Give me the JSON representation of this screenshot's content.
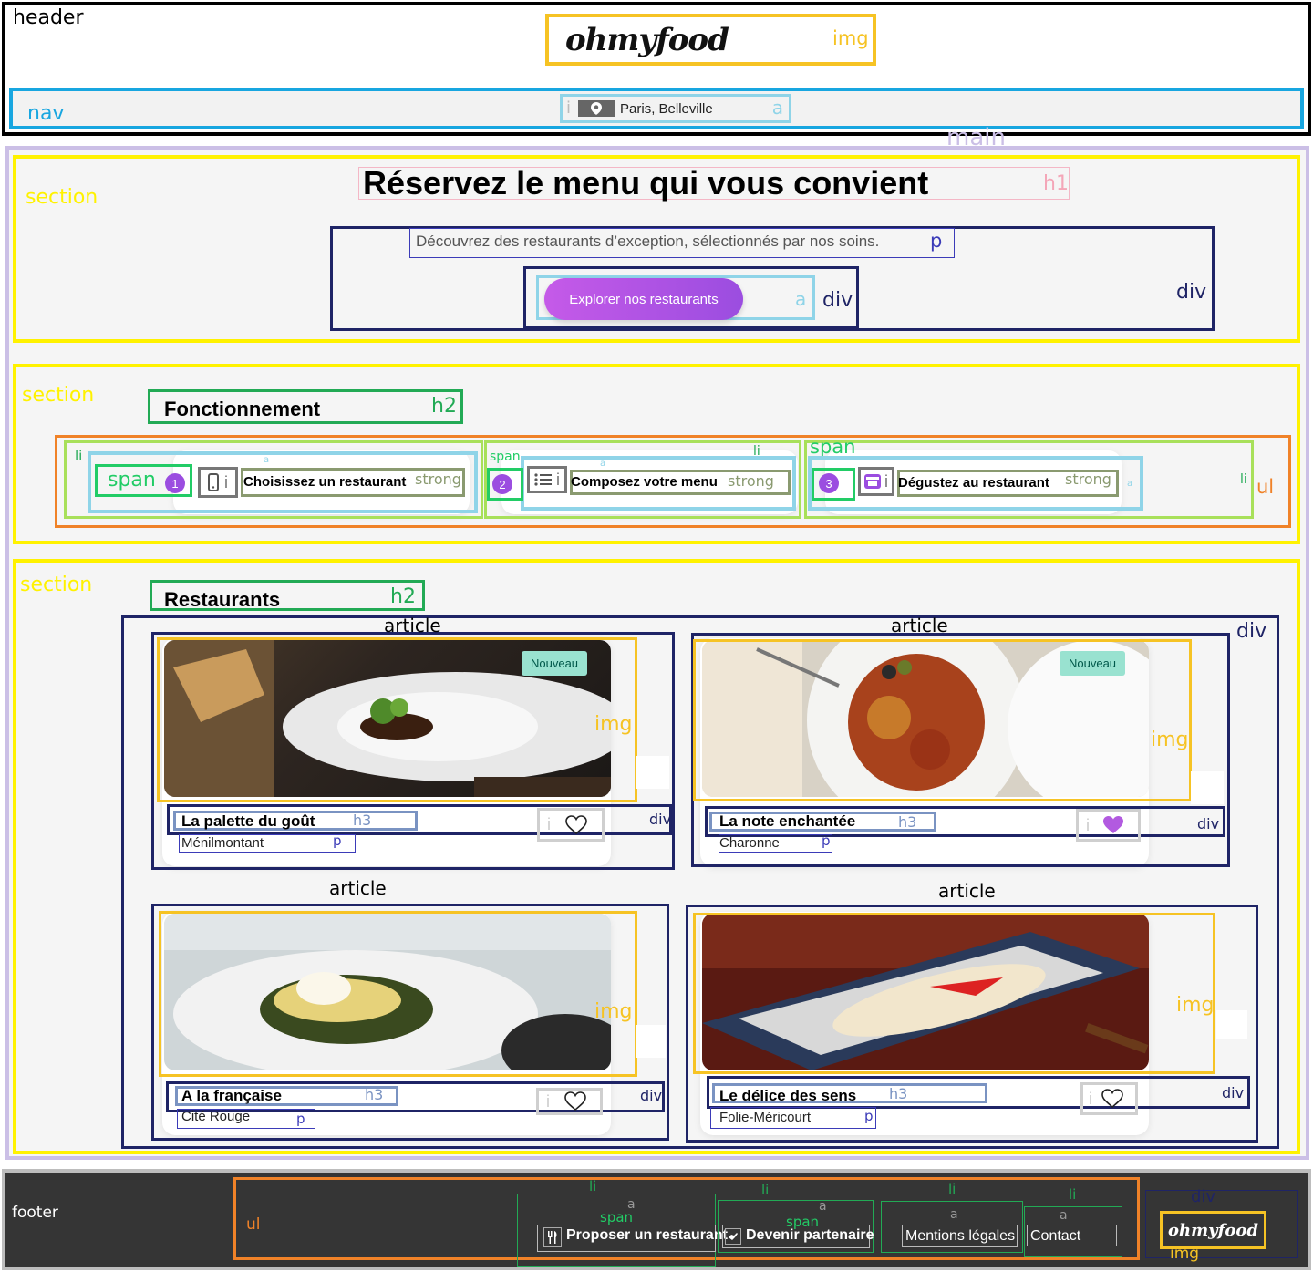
{
  "annotations": {
    "header": "header",
    "img": "img",
    "nav": "nav",
    "a": "a",
    "i": "i",
    "main": "main",
    "section": "section",
    "h1": "h1",
    "p": "p",
    "div": "div",
    "h2": "h2",
    "li": "li",
    "span": "span",
    "strong": "strong",
    "ul": "ul",
    "article": "article",
    "h3": "h3",
    "footer": "footer"
  },
  "header": {
    "logo": "ohmyfood",
    "location": "Paris, Belleville"
  },
  "hero": {
    "title": "Réservez le menu qui vous convient",
    "subtitle": "Découvrez des restaurants d’exception, sélectionnés par nos soins.",
    "cta": "Explorer nos restaurants"
  },
  "how": {
    "title": "Fonctionnement",
    "steps": [
      {
        "num": "1",
        "label": "Choisissez un restaurant",
        "icon": "mobile-icon"
      },
      {
        "num": "2",
        "label": "Composez votre menu",
        "icon": "list-icon"
      },
      {
        "num": "3",
        "label": "Dégustez au restaurant",
        "icon": "store-icon"
      }
    ]
  },
  "restaurants": {
    "title": "Restaurants",
    "badge": "Nouveau",
    "items": [
      {
        "name": "La palette du goût",
        "place": "Ménilmontant",
        "new": true,
        "liked": false
      },
      {
        "name": "La note enchantée",
        "place": "Charonne",
        "new": true,
        "liked": true
      },
      {
        "name": "A la française",
        "place": "Cité Rouge",
        "new": false,
        "liked": false
      },
      {
        "name": "Le délice des sens",
        "place": "Folie-Méricourt",
        "new": false,
        "liked": false
      }
    ]
  },
  "footer": {
    "links": [
      "Proposer un restaurant",
      "Devenir partenaire",
      "Mentions légales",
      "Contact"
    ],
    "logo": "ohmyfood"
  },
  "colors": {
    "accent": "#9b4de0",
    "header_outline": "#000000",
    "nav_outline": "#18a6e0",
    "section_outline": "#fff200",
    "img_outline": "#f6c324",
    "footer_bg": "#353535"
  }
}
